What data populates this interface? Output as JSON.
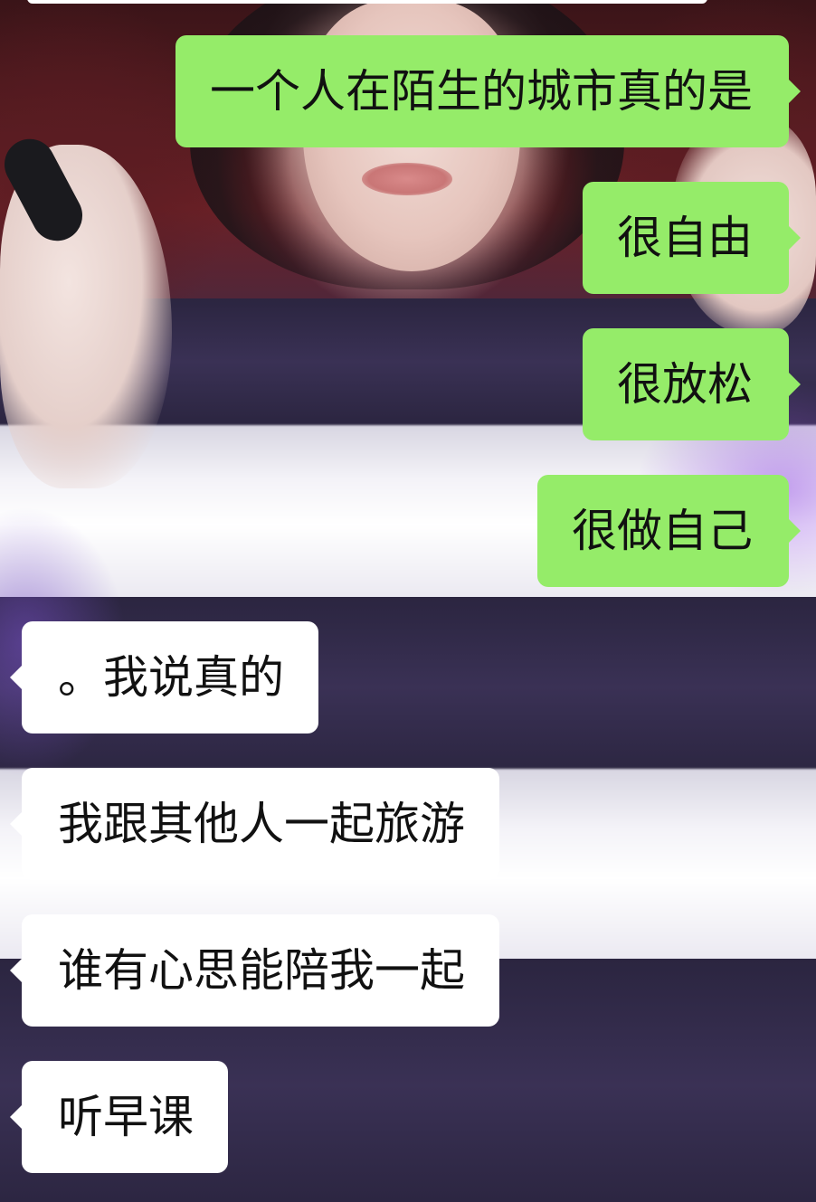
{
  "background": {
    "description_colors": {
      "backdrop_red": "#6a2026",
      "sweater_dark": "#2f2946",
      "sweater_light": "#f4f3f8",
      "accent_purple": "#9a64e6"
    }
  },
  "theme": {
    "sent_bubble_color": "#95ec69",
    "received_bubble_color": "#ffffff",
    "text_color": "#111111"
  },
  "messages": {
    "sent": [
      {
        "text": "一个人在陌生的城市真的是"
      },
      {
        "text": "很自由"
      },
      {
        "text": "很放松"
      },
      {
        "text": "很做自己"
      }
    ],
    "received": [
      {
        "text": "。我说真的"
      },
      {
        "text": "我跟其他人一起旅游"
      },
      {
        "text": "谁有心思能陪我一起"
      },
      {
        "text": "听早课"
      }
    ]
  }
}
